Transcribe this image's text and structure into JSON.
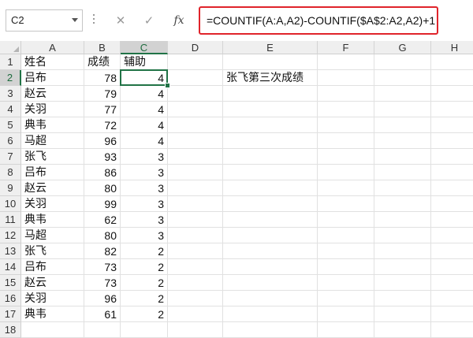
{
  "formula_bar": {
    "name_box": "C2",
    "cancel_symbol": "✕",
    "enter_symbol": "✓",
    "fx_label": "fx",
    "formula": "=COUNTIF(A:A,A2)-COUNTIF($A$2:A2,A2)+1"
  },
  "columns": [
    "A",
    "B",
    "C",
    "D",
    "E",
    "F",
    "G",
    "H"
  ],
  "selected_column": "C",
  "active_cell": "C2",
  "rows": [
    {
      "num": "1",
      "a": "姓名",
      "b": "成绩",
      "c": "辅助"
    },
    {
      "num": "2",
      "a": "吕布",
      "b": "78",
      "c": "4"
    },
    {
      "num": "3",
      "a": "赵云",
      "b": "79",
      "c": "4"
    },
    {
      "num": "4",
      "a": "关羽",
      "b": "77",
      "c": "4"
    },
    {
      "num": "5",
      "a": "典韦",
      "b": "72",
      "c": "4"
    },
    {
      "num": "6",
      "a": "马超",
      "b": "96",
      "c": "4"
    },
    {
      "num": "7",
      "a": "张飞",
      "b": "93",
      "c": "3"
    },
    {
      "num": "8",
      "a": "吕布",
      "b": "86",
      "c": "3"
    },
    {
      "num": "9",
      "a": "赵云",
      "b": "80",
      "c": "3"
    },
    {
      "num": "10",
      "a": "关羽",
      "b": "99",
      "c": "3"
    },
    {
      "num": "11",
      "a": "典韦",
      "b": "62",
      "c": "3"
    },
    {
      "num": "12",
      "a": "马超",
      "b": "80",
      "c": "3"
    },
    {
      "num": "13",
      "a": "张飞",
      "b": "82",
      "c": "2"
    },
    {
      "num": "14",
      "a": "吕布",
      "b": "73",
      "c": "2"
    },
    {
      "num": "15",
      "a": "赵云",
      "b": "73",
      "c": "2"
    },
    {
      "num": "16",
      "a": "关羽",
      "b": "96",
      "c": "2"
    },
    {
      "num": "17",
      "a": "典韦",
      "b": "61",
      "c": "2"
    },
    {
      "num": "18",
      "a": "",
      "b": "",
      "c": ""
    }
  ],
  "note_e2": "张飞第三次成绩"
}
